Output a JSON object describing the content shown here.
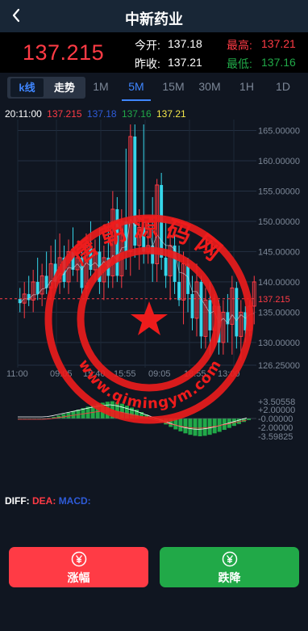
{
  "header": {
    "title": "中新药业",
    "back_icon": "chevron-left-icon"
  },
  "quote": {
    "price": "137.215",
    "open_label": "今开:",
    "open_value": "137.18",
    "high_label": "最高:",
    "high_value": "137.21",
    "prev_label": "昨收:",
    "prev_value": "137.21",
    "low_label": "最低:",
    "low_value": "137.16"
  },
  "tabs": {
    "kline": "k线",
    "trend": "走势",
    "periods": [
      "1M",
      "5M",
      "15M",
      "30M",
      "1H",
      "1D"
    ],
    "active": "5M"
  },
  "legend": {
    "time": "20:11:00",
    "v1": "137.215",
    "v2": "137.18",
    "v3": "137.16",
    "v4": "137.21"
  },
  "colors": {
    "up": "#ff3b45",
    "down": "#36d6ea",
    "green": "#21a948",
    "blue": "#3f86ff",
    "yellow": "#f5e84a"
  },
  "chart_data": {
    "type": "candlestick",
    "y_ticks": [
      "165.00000",
      "160.00000",
      "155.00000",
      "150.00000",
      "145.00000",
      "140.00000",
      "135.00000",
      "130.00000",
      "126.25000"
    ],
    "y_range": [
      126.25,
      166
    ],
    "x_ticks": [
      "11:00",
      "09:05",
      "15:40",
      "15:55",
      "09:05",
      "18:55",
      "13:00"
    ],
    "current_price_label": "137.215",
    "current_price": 137.215,
    "candles": [
      [
        137.2,
        139,
        135,
        136.5
      ],
      [
        136.5,
        140,
        134,
        138
      ],
      [
        138,
        141,
        136,
        137
      ],
      [
        137,
        142,
        135,
        140
      ],
      [
        140,
        144,
        137,
        138
      ],
      [
        138,
        143,
        136,
        141
      ],
      [
        141,
        145,
        138,
        139
      ],
      [
        139,
        146,
        137,
        143
      ],
      [
        143,
        147,
        139,
        140
      ],
      [
        140,
        148,
        138,
        144
      ],
      [
        144,
        146,
        139,
        140
      ],
      [
        140,
        147,
        138,
        145
      ],
      [
        145,
        149,
        141,
        142
      ],
      [
        142,
        146,
        140,
        144
      ],
      [
        144,
        145,
        138,
        139
      ],
      [
        139,
        148,
        137,
        146
      ],
      [
        146,
        150,
        141,
        142
      ],
      [
        142,
        147,
        140,
        145
      ],
      [
        145,
        149,
        138,
        140
      ],
      [
        140,
        146,
        137,
        144
      ],
      [
        144,
        150,
        139,
        141
      ],
      [
        141,
        155,
        139,
        152
      ],
      [
        152,
        154,
        140,
        141
      ],
      [
        141,
        152,
        139,
        150
      ],
      [
        150,
        162,
        142,
        145
      ],
      [
        145,
        166,
        141,
        164
      ],
      [
        164,
        166,
        144,
        146
      ],
      [
        146,
        152,
        142,
        149
      ],
      [
        149,
        166,
        143,
        145
      ],
      [
        145,
        150,
        143,
        146
      ],
      [
        146,
        154,
        140,
        143
      ],
      [
        143,
        157,
        140,
        156
      ],
      [
        156,
        158,
        142,
        144
      ],
      [
        144,
        150,
        139,
        141
      ],
      [
        141,
        148,
        137,
        146
      ],
      [
        146,
        148,
        138,
        140
      ],
      [
        140,
        146,
        136,
        137
      ],
      [
        137,
        145,
        133,
        143
      ],
      [
        143,
        144,
        135,
        138
      ],
      [
        138,
        141,
        132,
        134
      ],
      [
        134,
        143,
        131,
        140
      ],
      [
        140,
        141,
        129,
        131
      ],
      [
        131,
        139,
        129,
        137
      ],
      [
        137,
        140,
        128,
        132
      ],
      [
        132,
        138,
        129,
        136
      ],
      [
        136,
        137,
        128,
        130
      ],
      [
        130,
        137,
        128,
        135
      ],
      [
        135,
        138,
        130,
        133
      ],
      [
        133,
        141,
        128,
        139
      ],
      [
        139,
        140,
        129,
        131
      ],
      [
        131,
        137,
        127,
        135
      ],
      [
        135,
        136,
        130,
        132
      ],
      [
        132,
        137,
        131,
        136
      ],
      [
        136,
        141,
        133,
        140
      ]
    ],
    "macd": {
      "ticks": [
        "+3.50558",
        "+2.00000",
        "-0.00000",
        "-2.00000",
        "-3.59825"
      ],
      "range": [
        -3.59825,
        3.50558
      ],
      "bars": [
        0,
        0,
        0,
        0,
        0,
        0,
        0.1,
        0.3,
        0.6,
        0.9,
        1.2,
        1.5,
        1.8,
        2.1,
        2.4,
        2.7,
        3.0,
        3.2,
        3.4,
        3.5,
        3.3,
        3.0,
        2.6,
        2.2,
        1.8,
        1.3,
        0.8,
        0.3,
        -0.2,
        -0.7,
        -1.2,
        -1.7,
        -2.2,
        -2.6,
        -3.0,
        -3.3,
        -3.5,
        -3.6,
        -3.5,
        -3.3,
        -3.0,
        -2.7,
        -2.3,
        -1.9,
        -1.5,
        -1.1,
        -0.7,
        -0.3
      ]
    }
  },
  "macd_labels": {
    "diff": "DIFF:",
    "dea": "DEA:",
    "macd": "MACD:"
  },
  "buttons": {
    "up": {
      "label": "涨幅",
      "icon": "yen-coin-icon"
    },
    "down": {
      "label": "跌降",
      "icon": "yen-coin-icon"
    }
  },
  "watermark": {
    "top": "唐朝源码网",
    "bottom": "www.qimingym.com"
  }
}
